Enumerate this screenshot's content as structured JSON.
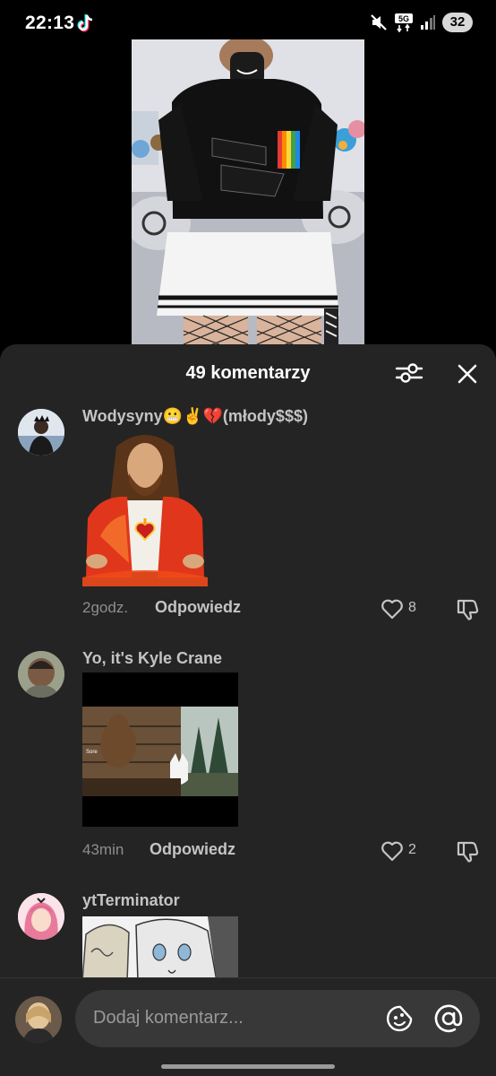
{
  "status_bar": {
    "time": "22:13",
    "network": "5G",
    "battery": "32",
    "icons": [
      "tiktok-icon",
      "mute-icon",
      "5g-icon",
      "signal-icon",
      "battery-icon"
    ]
  },
  "video": {
    "description_icon": "video-frame"
  },
  "comments_sheet": {
    "title": "49 komentarzy",
    "filter_icon": "sliders-icon",
    "close_icon": "close-icon"
  },
  "comments": [
    {
      "username": "Wodysyny😬✌️💔(młody$$$)",
      "media": "sticker-image",
      "timestamp": "2godz.",
      "reply_label": "Odpowiedz",
      "likes": "8"
    },
    {
      "username": "Yo, it's Kyle Crane",
      "media": "gif-image",
      "media_caption": "Sore",
      "timestamp": "43min",
      "reply_label": "Odpowiedz",
      "likes": "2"
    },
    {
      "username": "ytTerminator",
      "media": "anime-image"
    }
  ],
  "composer": {
    "placeholder": "Dodaj komentarz...",
    "emoji_icon": "emoji-icon",
    "mention_icon": "at-icon"
  },
  "colors": {
    "sheet_bg": "#242424",
    "input_bg": "#383838",
    "text_primary": "#ffffff",
    "text_secondary": "#c4c4c4",
    "text_muted": "#8e8e8e"
  }
}
